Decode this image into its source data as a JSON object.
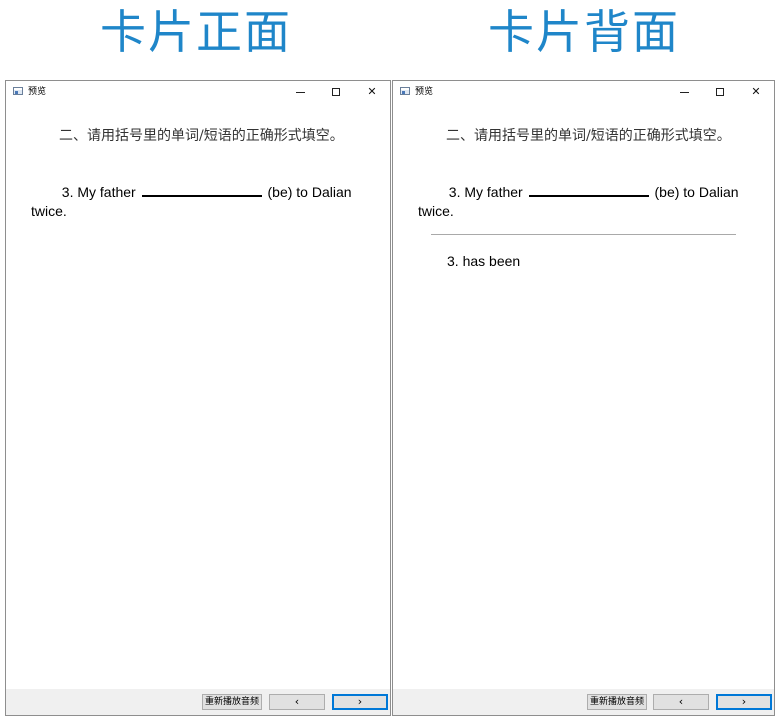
{
  "headings": {
    "front": "卡片正面",
    "back": "卡片背面"
  },
  "window": {
    "title": "预览"
  },
  "card": {
    "instruction": "二、请用括号里的单词/短语的正确形式填空。",
    "question_before_blank": "3. My father ",
    "question_after_blank": " (be) to Dalian twice.",
    "answer": "3. has been"
  },
  "controls": {
    "replay_label": "重新播放音频",
    "prev_label": "‹",
    "next_label": "›",
    "min_icon": "minimize-icon",
    "max_icon": "maximize-icon",
    "close_label": "✕"
  },
  "colors": {
    "heading": "#1f86c9",
    "focus": "#0078d7"
  }
}
